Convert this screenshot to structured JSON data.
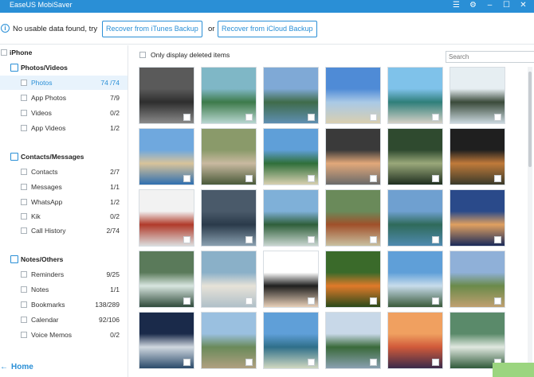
{
  "app": {
    "title": "EaseUS MobiSaver"
  },
  "window_controls": [
    "menu-icon",
    "settings-icon",
    "minimize-icon",
    "maximize-icon",
    "close-icon"
  ],
  "notice": {
    "message": "No usable data found, try",
    "itunes_button": "Recover from iTunes Backup",
    "or": "or",
    "icloud_button": "Recover from iCloud Backup"
  },
  "sidebar": {
    "device": "iPhone",
    "groups": [
      {
        "title": "Photos/Videos",
        "icon": "photo-icon",
        "items": [
          {
            "label": "Photos",
            "count": "74 /74"
          },
          {
            "label": "App Photos",
            "count": "7/9"
          },
          {
            "label": "Videos",
            "count": "0/2"
          },
          {
            "label": "App Videos",
            "count": "1/2"
          }
        ]
      },
      {
        "title": "Contacts/Messages",
        "icon": "contacts-icon",
        "items": [
          {
            "label": "Contacts",
            "count": "2/7"
          },
          {
            "label": "Messages",
            "count": "1/1"
          },
          {
            "label": "WhatsApp",
            "count": "1/2"
          },
          {
            "label": "Kik",
            "count": "0/2"
          },
          {
            "label": "Call History",
            "count": "2/74"
          }
        ]
      },
      {
        "title": "Notes/Others",
        "icon": "notes-icon",
        "items": [
          {
            "label": "Reminders",
            "count": "9/25"
          },
          {
            "label": "Notes",
            "count": "1/1"
          },
          {
            "label": "Bookmarks",
            "count": "138/289"
          },
          {
            "label": "Calendar",
            "count": "92/106"
          },
          {
            "label": "Voice Memos",
            "count": "0/2"
          }
        ]
      }
    ],
    "home": "Home"
  },
  "toolbar": {
    "only_deleted_label": "Only display deleted items",
    "search_placeholder": "Search"
  },
  "colors": {
    "accent": "#2a8fd6",
    "recover_button": "#9bd57f"
  },
  "thumbnails": [
    {
      "name": "ruins-bw",
      "c": [
        "#5a5a5a",
        "#2e2e2e",
        "#8a8a8a"
      ]
    },
    {
      "name": "island-bay",
      "c": [
        "#7fb7c6",
        "#3d7a4a",
        "#b7d6d0"
      ]
    },
    {
      "name": "limestone-island",
      "c": [
        "#7fa9d6",
        "#3f6b4a",
        "#5f8fb2"
      ]
    },
    {
      "name": "beach-blue-sky",
      "c": [
        "#4f8bd6",
        "#a9c9e6",
        "#d9cfb0"
      ]
    },
    {
      "name": "beach-hammock",
      "c": [
        "#7fc2ea",
        "#2f7f7a",
        "#d4d0c6"
      ]
    },
    {
      "name": "palm-silhouette",
      "c": [
        "#e6eef2",
        "#3a4a3a",
        "#c9d7de"
      ]
    },
    {
      "name": "beach-couple",
      "c": [
        "#6fa8de",
        "#d8c39a",
        "#2f6fb0"
      ]
    },
    {
      "name": "tree-house",
      "c": [
        "#8a9a6a",
        "#c9b9a0",
        "#4a5a3a"
      ]
    },
    {
      "name": "palm-beach",
      "c": [
        "#5f9fd8",
        "#2f6f3a",
        "#d8d0b0"
      ]
    },
    {
      "name": "girl-rocks",
      "c": [
        "#3a3a3a",
        "#e2a87a",
        "#6a6a6a"
      ]
    },
    {
      "name": "jungle-resort",
      "c": [
        "#2f4a2f",
        "#9aa87a",
        "#1f2f1f"
      ]
    },
    {
      "name": "sunset-palms",
      "c": [
        "#1f1f1f",
        "#c07a3a",
        "#3a3a2a"
      ]
    },
    {
      "name": "red-kayak",
      "c": [
        "#f2f2f2",
        "#b03a2a",
        "#dcdcdc"
      ]
    },
    {
      "name": "tourists-cave",
      "c": [
        "#4a5a6a",
        "#2a3a4a",
        "#8aa0b0"
      ]
    },
    {
      "name": "green-cliffs",
      "c": [
        "#7fb0d8",
        "#2f5f3a",
        "#c9d6d0"
      ]
    },
    {
      "name": "shack",
      "c": [
        "#6a8a5a",
        "#a0502a",
        "#c9c0a0"
      ]
    },
    {
      "name": "river-palms",
      "c": [
        "#6fa0d0",
        "#2f6a5a",
        "#4f8ab0"
      ]
    },
    {
      "name": "dusk-sea",
      "c": [
        "#2a4a8a",
        "#e0a060",
        "#1a2a5a"
      ]
    },
    {
      "name": "waterfall",
      "c": [
        "#5a7a5a",
        "#d8e6e0",
        "#2f4a3a"
      ]
    },
    {
      "name": "bride-sea",
      "c": [
        "#8ab0c8",
        "#e6e2d8",
        "#b0c0c8"
      ]
    },
    {
      "name": "woman-white",
      "c": [
        "#ffffff",
        "#1f1f1f",
        "#e8d0b8"
      ]
    },
    {
      "name": "orange-bird",
      "c": [
        "#3a6a2a",
        "#e07a2a",
        "#2a4a1a"
      ]
    },
    {
      "name": "lone-palm",
      "c": [
        "#5f9fd8",
        "#c8dceb",
        "#3a5a3a"
      ]
    },
    {
      "name": "fountain-garden",
      "c": [
        "#8fb0d8",
        "#6a8a4a",
        "#c0a070"
      ]
    },
    {
      "name": "dark-sky",
      "c": [
        "#1a2a4a",
        "#d0d8e0",
        "#2a4a6a"
      ]
    },
    {
      "name": "cottage",
      "c": [
        "#9ac0e0",
        "#6a8a5a",
        "#b0a080"
      ]
    },
    {
      "name": "coast-bay",
      "c": [
        "#5f9fd8",
        "#2f6f8a",
        "#d0d8c0"
      ]
    },
    {
      "name": "forest-clouds",
      "c": [
        "#c8d8e8",
        "#3a6a3a",
        "#8aa0b0"
      ]
    },
    {
      "name": "orange-sunset",
      "c": [
        "#f0a060",
        "#d05a3a",
        "#3a2a4a"
      ]
    },
    {
      "name": "cascade",
      "c": [
        "#5a8a6a",
        "#e0e8e0",
        "#2f5a3a"
      ]
    }
  ]
}
